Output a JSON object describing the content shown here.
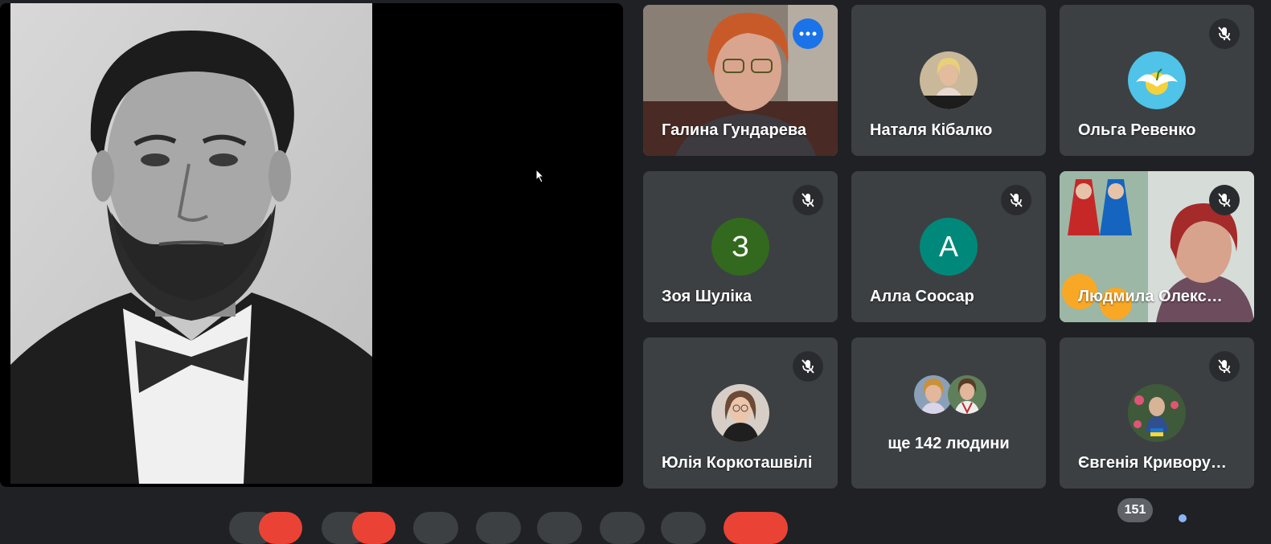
{
  "participants": [
    {
      "name": "Галина Гундарева",
      "active": true
    },
    {
      "name": "Наталя Кібалко",
      "muted": false
    },
    {
      "name": "Ольга Ревенко",
      "muted": true
    },
    {
      "name": "Зоя Шуліка",
      "initial": "З",
      "avatar_color": "#33691e",
      "muted": true
    },
    {
      "name": "Алла Соосар",
      "initial": "А",
      "avatar_color": "#00897b",
      "muted": true
    },
    {
      "name": "Людмила Олекс…",
      "muted": true
    },
    {
      "name": "Юлія Коркоташвілі",
      "muted": true
    },
    {
      "name": "Євгенія Кривору…",
      "muted": true
    }
  ],
  "more_people": {
    "label": "ще 142 людини"
  },
  "participant_count": "151",
  "colors": {
    "background": "#202124",
    "tile": "#3c4043",
    "accent": "#8ab4f8",
    "leave": "#ea4335"
  }
}
